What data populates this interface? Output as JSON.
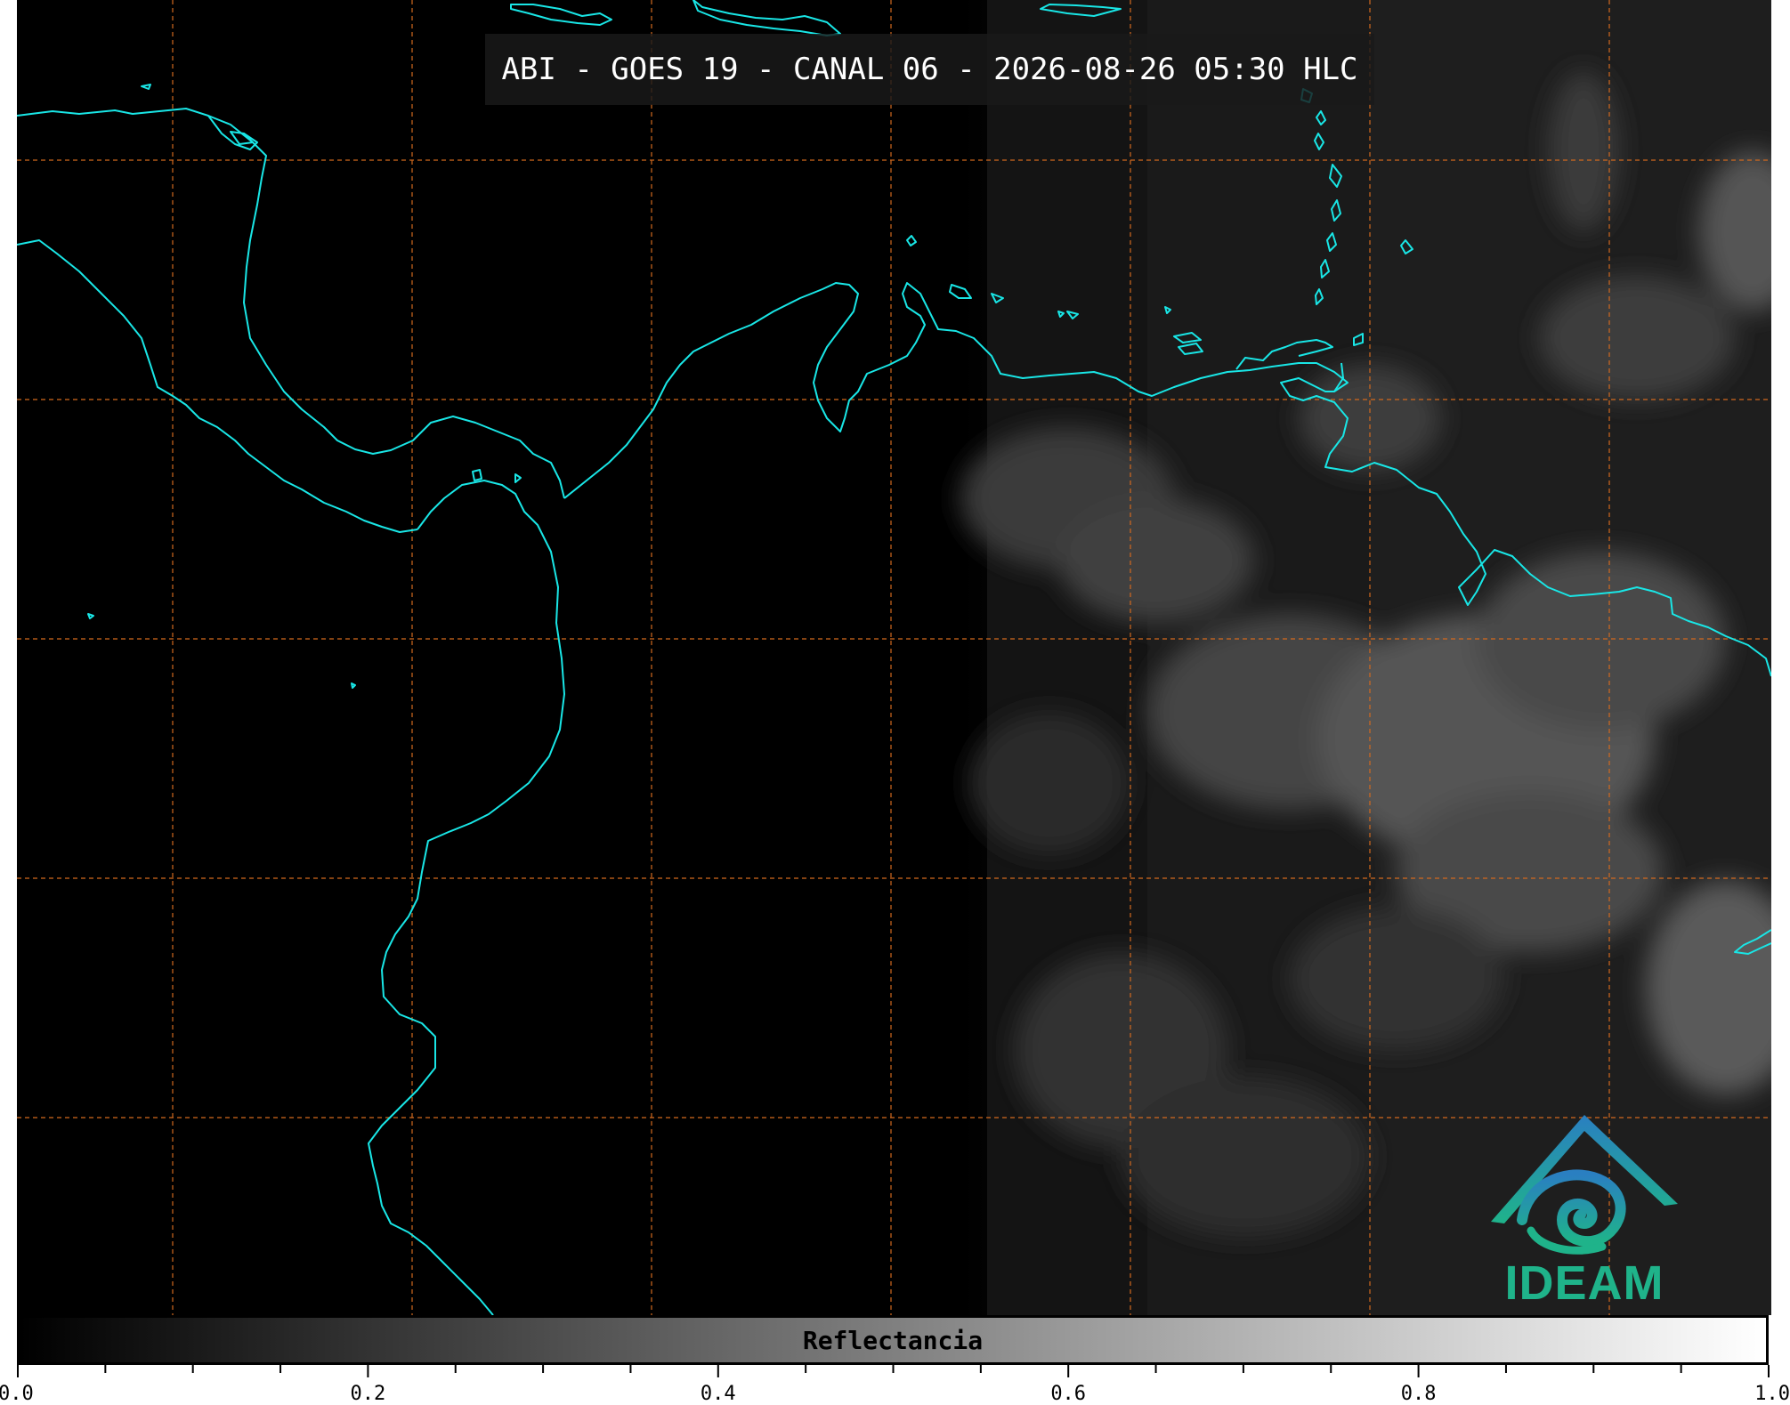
{
  "title": "ABI - GOES 19 - CANAL 06 - 2026-08-26 05:30 HLC",
  "colors": {
    "coastline": "#19e6e6",
    "grid": "#d2691e",
    "background": "#000000",
    "logo_primary": "#1fb38a",
    "logo_secondary": "#2a7fc1"
  },
  "logo": {
    "icon": "ideam-logo-icon",
    "text": "IDEAM"
  },
  "colorbar": {
    "label": "Reflectancia",
    "colormap": "grayscale",
    "range": [
      0.0,
      1.0
    ],
    "major_ticks": [
      "0.0",
      "0.2",
      "0.4",
      "0.6",
      "0.8",
      "1.0"
    ],
    "minor_tick_step": 0.05
  },
  "grid": {
    "style": "dashed",
    "shown": true
  }
}
